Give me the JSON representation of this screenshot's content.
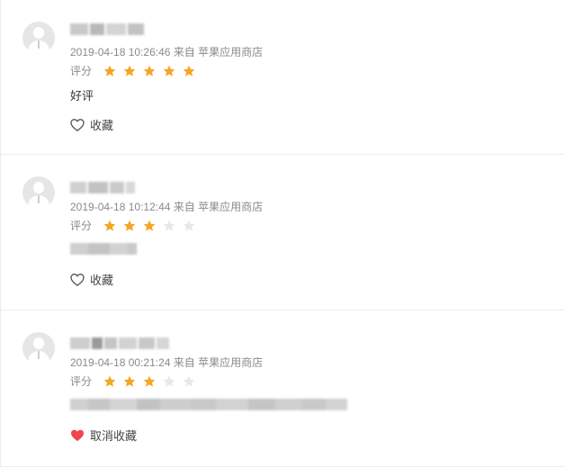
{
  "colors": {
    "star_active": "#F5A623",
    "star_inactive": "#E8E8E8",
    "heart_active": "#F0474E",
    "heart_outline": "#555555"
  },
  "reviews": [
    {
      "username": "",
      "meta": "2019-04-18 10:26:46 来自 苹果应用商店",
      "rating_label": "评分",
      "rating": 5,
      "content": "好评",
      "favorite_label": "收藏",
      "favorited": false
    },
    {
      "username": "",
      "meta": "2019-04-18 10:12:44 来自 苹果应用商店",
      "rating_label": "评分",
      "rating": 3,
      "content": "",
      "favorite_label": "收藏",
      "favorited": false
    },
    {
      "username": "",
      "meta": "2019-04-18 00:21:24 来自 苹果应用商店",
      "rating_label": "评分",
      "rating": 3,
      "content": "",
      "favorite_label": "取消收藏",
      "favorited": true
    }
  ]
}
